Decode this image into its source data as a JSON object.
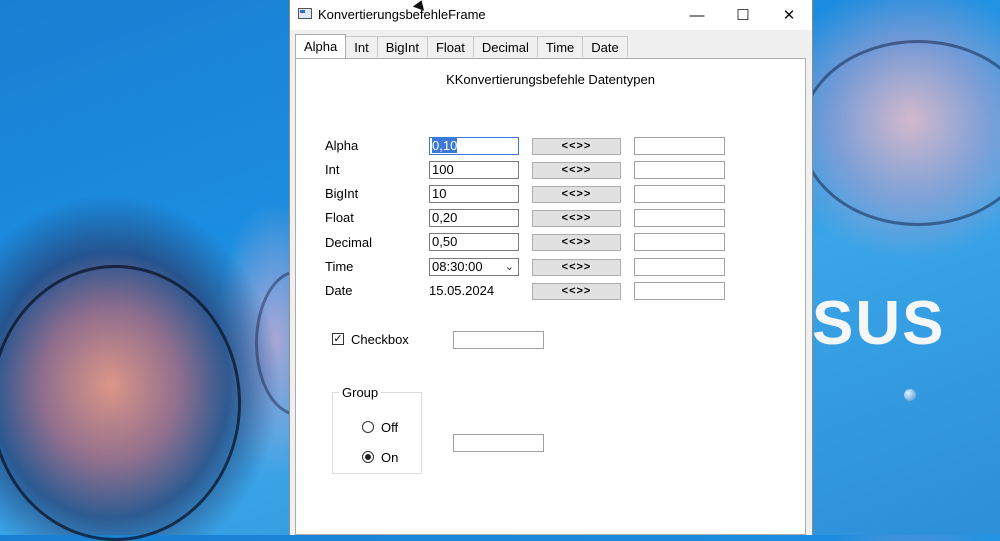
{
  "window": {
    "title": "KonvertierungsbefehleFrame",
    "controls": {
      "minimize": "—",
      "maximize": "☐",
      "close": "✕"
    }
  },
  "tabs": [
    {
      "label": "Alpha",
      "active": true
    },
    {
      "label": "Int"
    },
    {
      "label": "BigInt"
    },
    {
      "label": "Float"
    },
    {
      "label": "Decimal"
    },
    {
      "label": "Time"
    },
    {
      "label": "Date"
    }
  ],
  "panel": {
    "heading": "KKonvertierungsbefehle Datentypen",
    "rows": [
      {
        "label": "Alpha",
        "value": "0,10",
        "button": "<<>>",
        "output": ""
      },
      {
        "label": "Int",
        "value": "100",
        "button": "<<>>",
        "output": ""
      },
      {
        "label": "BigInt",
        "value": "10",
        "button": "<<>>",
        "output": ""
      },
      {
        "label": "Float",
        "value": "0,20",
        "button": "<<>>",
        "output": ""
      },
      {
        "label": "Decimal",
        "value": "0,50",
        "button": "<<>>",
        "output": ""
      },
      {
        "label": "Time",
        "value": "08:30:00",
        "button": "<<>>",
        "output": ""
      },
      {
        "label": "Date",
        "value": "15.05.2024",
        "button": "<<>>",
        "output": ""
      }
    ],
    "checkbox": {
      "label": "Checkbox",
      "checked": true,
      "output": ""
    },
    "group": {
      "label": "Group",
      "options": [
        {
          "label": "Off",
          "selected": false
        },
        {
          "label": "On",
          "selected": true
        }
      ],
      "output": ""
    }
  },
  "desktop": {
    "brand_text": "SUS"
  }
}
